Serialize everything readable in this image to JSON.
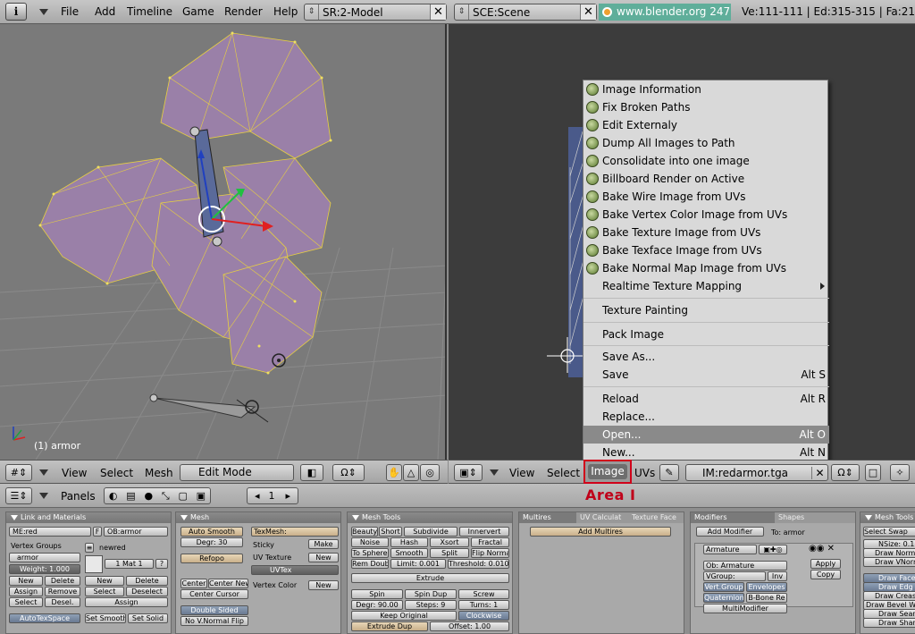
{
  "topbar": {
    "info_glyph": "i",
    "menus": [
      "File",
      "Add",
      "Timeline",
      "Game",
      "Render",
      "Help"
    ],
    "screen": "SR:2-Model",
    "scene": "SCE:Scene",
    "url": "www.blender.org 247.1",
    "stats": "Ve:111-111 | Ed:315-315 | Fa:21"
  },
  "view3d": {
    "object_label": "(1) armor",
    "header": {
      "view": "View",
      "select": "Select",
      "mesh": "Mesh",
      "mode": "Edit Mode"
    }
  },
  "image_editor": {
    "header": {
      "view": "View",
      "select": "Select",
      "image": "Image",
      "uvs": "UVs",
      "image_name": "IM:redarmor.tga"
    },
    "menu": {
      "items": [
        {
          "label": "Image Information"
        },
        {
          "label": "Fix Broken Paths"
        },
        {
          "label": "Edit Externaly"
        },
        {
          "label": "Dump All Images to Path"
        },
        {
          "label": "Consolidate into one image"
        },
        {
          "label": "Billboard Render on Active"
        },
        {
          "label": "Bake Wire Image from UVs"
        },
        {
          "label": "Bake Vertex Color Image from UVs"
        },
        {
          "label": "Bake Texture Image from UVs"
        },
        {
          "label": "Bake Texface Image from UVs"
        },
        {
          "label": "Bake Normal Map Image from UVs"
        },
        {
          "label": "Realtime Texture Mapping"
        },
        {
          "label": "Texture Painting"
        },
        {
          "label": "Pack Image"
        },
        {
          "label": "Save As..."
        },
        {
          "label": "Save",
          "shortcut": "Alt S"
        },
        {
          "label": "Reload",
          "shortcut": "Alt R"
        },
        {
          "label": "Replace..."
        },
        {
          "label": "Open...",
          "shortcut": "Alt O"
        },
        {
          "label": "New...",
          "shortcut": "Alt N"
        }
      ]
    }
  },
  "annotation": "Area I",
  "buttons_header": {
    "panels_label": "Panels",
    "frame": "1"
  },
  "panels": {
    "link": {
      "title": "Link and Materials",
      "me": "ME:red",
      "f": "F",
      "ob": "OB:armor",
      "vertex_groups": "Vertex Groups",
      "group_name": "armor",
      "weight": "Weight: 1.000",
      "new": "New",
      "delete": "Delete",
      "assign": "Assign",
      "remove": "Remove",
      "select": "Select",
      "desel": "Desel.",
      "autotex": "AutoTexSpace",
      "mat_name": "newred",
      "mat_index": "1 Mat 1",
      "mat_q": "?",
      "new2": "New",
      "delete2": "Delete",
      "select2": "Select",
      "deselect2": "Deselect",
      "assign2": "Assign",
      "set_smooth": "Set Smooth",
      "set_solid": "Set Solid"
    },
    "mesh": {
      "title": "Mesh",
      "auto_smooth": "Auto Smooth",
      "degr": "Degr: 30",
      "refopo": "Refopo",
      "center": "Center",
      "center_new": "Center New",
      "center_cursor": "Center Cursor",
      "double_sided": "Double Sided",
      "no_vnormal": "No V.Normal Flip",
      "texmesh": "TexMesh:",
      "sticky": "Sticky",
      "make": "Make",
      "uv_texture": "UV Texture",
      "new": "New",
      "uvtex": "UVTex",
      "vertex_color": "Vertex Color",
      "new2": "New"
    },
    "meshtools": {
      "title": "Mesh Tools",
      "beauty": "Beauty",
      "short": "Short",
      "subdivide": "Subdivide",
      "innervert": "Innervert",
      "noise": "Noise",
      "hash": "Hash",
      "xsort": "Xsort",
      "fractal": "Fractal",
      "to_sphere": "To Sphere",
      "smooth": "Smooth",
      "split": "Split",
      "flip_normal": "Flip Normal",
      "rem_doubl": "Rem Doubl",
      "limit": "Limit: 0.001",
      "threshold": "Threshold: 0.010",
      "extrude": "Extrude",
      "spin": "Spin",
      "spin_dup": "Spin Dup",
      "screw": "Screw",
      "degr": "Degr: 90.00",
      "steps": "Steps: 9",
      "turns": "Turns: 1",
      "keep_original": "Keep Original",
      "clockwise": "Clockwise",
      "extrude_dup": "Extrude Dup",
      "offset": "Offset: 1.00"
    },
    "multires": {
      "tab1": "Multires",
      "tab2": "UV Calculat",
      "tab3": "Texture Face",
      "add": "Add Multires"
    },
    "modifiers": {
      "tab1": "Modifiers",
      "tab2": "Shapes",
      "add": "Add Modifier",
      "to": "To: armor",
      "mod_name": "Armature",
      "apply": "Apply",
      "copy": "Copy",
      "ob": "Ob: Armature",
      "vgroup": "VGroup:",
      "inv": "Inv",
      "vert_group": "Vert.Group",
      "envelopes": "Envelopes",
      "quaternion": "Quaternion",
      "bbone": "B-Bone Re",
      "multimodifier": "MultiModifier"
    },
    "meshtools2": {
      "title": "Mesh Tools",
      "select_swap": "Select Swap",
      "nsize": "NSize: 0.1",
      "draw_norm": "Draw Norm",
      "draw_vnorm": "Draw VNorm",
      "draw_face": "Draw Face",
      "draw_edge": "Draw Edg",
      "draw_crease": "Draw Creas",
      "draw_bevel": "Draw Bevel W",
      "draw_seam": "Draw Sear",
      "draw_sharp": "Draw Shar"
    }
  }
}
